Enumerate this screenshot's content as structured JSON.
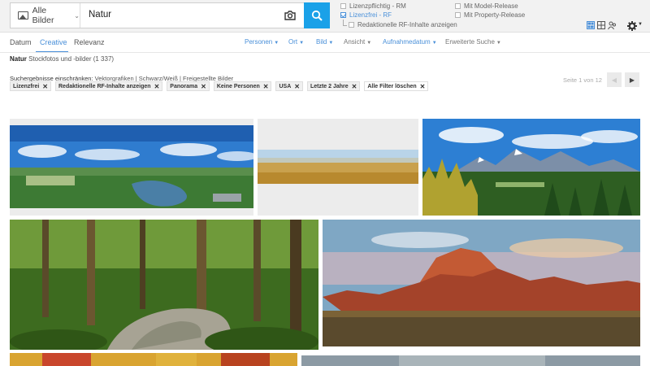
{
  "search": {
    "scope_label": "Alle Bilder",
    "query": "Natur"
  },
  "license_filters": {
    "rm": "Lizenzpflichtig - RM",
    "rf": "Lizenzfrei - RF",
    "rf_editorial": "Redaktionelle RF-Inhalte anzeigen",
    "model_release": "Mit Model-Release",
    "property_release": "Mit Property-Release"
  },
  "sort_tabs": [
    "Datum",
    "Creative",
    "Relevanz"
  ],
  "menus": {
    "personen": "Personen",
    "ort": "Ort",
    "bild": "Bild",
    "ansicht": "Ansicht",
    "aufnahmedatum": "Aufnahmedatum",
    "erweiterte_suche": "Erweiterte Suche"
  },
  "results": {
    "term": "Natur",
    "summary": "Stockfotos und -bilder (1 337)"
  },
  "refine": {
    "lead": "Suchergebnisse einschränken:",
    "links": "Vektorgrafiken | Schwarz/Weiß | Freigestellte Bilder"
  },
  "chips": [
    "Lizenzfrei",
    "Redaktionelle RF-Inhalte anzeigen",
    "Panorama",
    "Keine Personen",
    "USA",
    "Letzte 2 Jahre",
    "Alle Filter löschen"
  ],
  "pagination": {
    "info": "Seite 1 von 12",
    "prev": "◀",
    "next": "▶"
  },
  "colors": {
    "accent": "#4a90d9",
    "search_button": "#1aa1e8"
  }
}
